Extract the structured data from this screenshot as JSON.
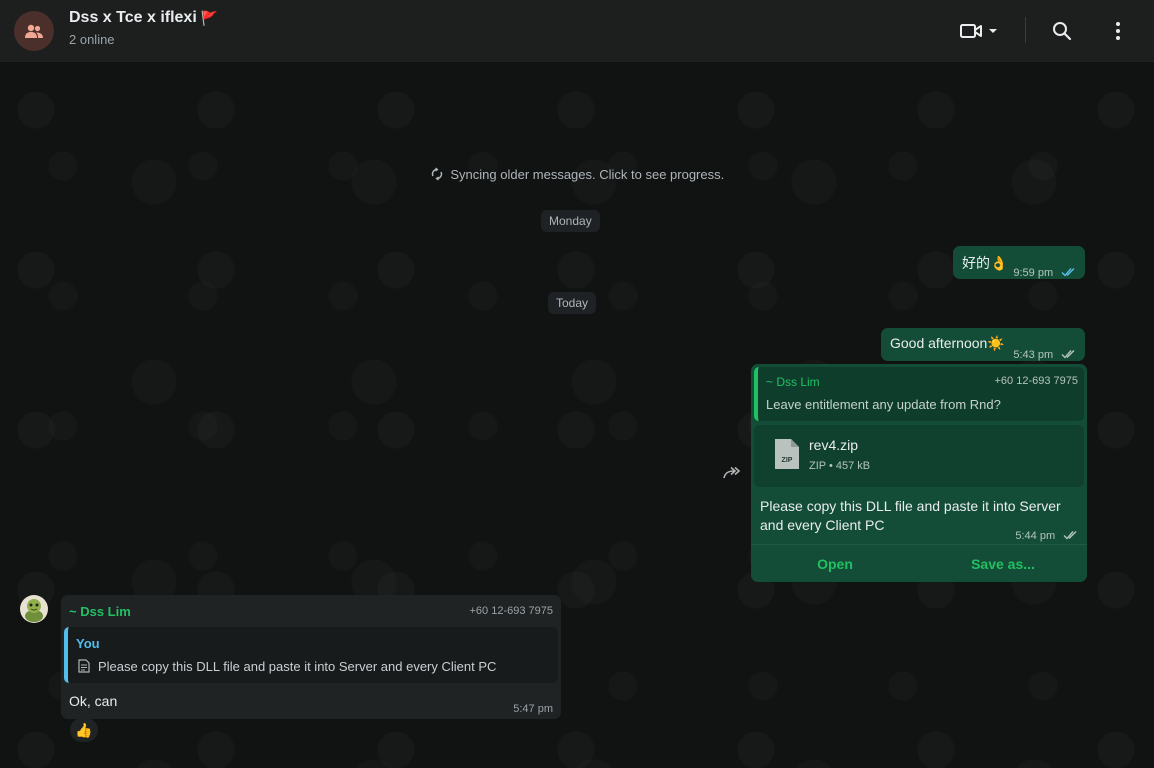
{
  "header": {
    "title": "Dss x Tce x iflexi",
    "title_emoji": "🚩",
    "subtitle": "2 online"
  },
  "chat": {
    "sync_text": "Syncing older messages. Click to see progress.",
    "day_monday": "Monday",
    "day_today": "Today",
    "msg1": {
      "text": "好的👌",
      "time": "9:59 pm"
    },
    "msg2": {
      "text": "Good afternoon☀️",
      "time": "5:43 pm"
    },
    "msg3": {
      "quote_author": "~ Dss Lim",
      "quote_phone": "+60 12-693 7975",
      "quote_text": "Leave entitlement any update from Rnd?",
      "file_name": "rev4.zip",
      "file_icon_label": "ZIP",
      "file_meta": "ZIP • 457 kB",
      "text": "Please copy this DLL file and paste it into Server and every Client PC",
      "time": "5:44 pm",
      "open_label": "Open",
      "save_label": "Save as..."
    },
    "msg4": {
      "author": "~ Dss Lim",
      "phone": "+60 12-693 7975",
      "quote_author": "You",
      "quote_text": "Please copy this DLL file and paste it into Server and every Client PC",
      "text": "Ok, can",
      "time": "5:47 pm",
      "reaction": "👍"
    }
  },
  "colors": {
    "accent": "#21c063",
    "outgoing_bubble": "#144d37",
    "incoming_bubble": "#1f2324",
    "read_tick": "#53bdeb"
  }
}
